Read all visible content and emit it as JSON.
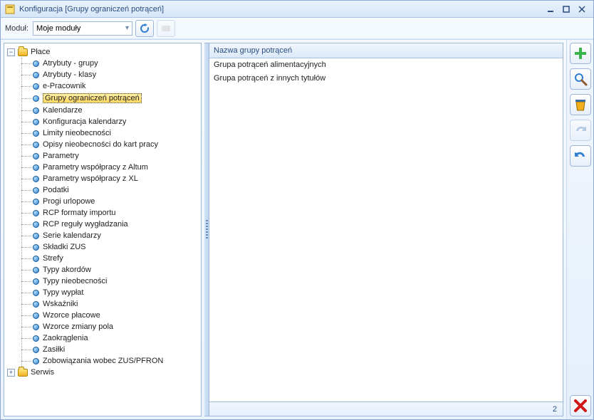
{
  "window": {
    "title": "Konfiguracja [Grupy ograniczeń potrąceń]"
  },
  "toolbar": {
    "module_label": "Moduł:",
    "module_value": "Moje moduły"
  },
  "tree": {
    "roots": [
      {
        "label": "Płace",
        "expanded": true,
        "children": [
          {
            "label": "Atrybuty - grupy"
          },
          {
            "label": "Atrybuty - klasy"
          },
          {
            "label": "e-Pracownik"
          },
          {
            "label": "Grupy ograniczeń potrąceń",
            "selected": true
          },
          {
            "label": "Kalendarze"
          },
          {
            "label": "Konfiguracja kalendarzy"
          },
          {
            "label": "Limity nieobecności"
          },
          {
            "label": "Opisy nieobecności do kart pracy"
          },
          {
            "label": "Parametry"
          },
          {
            "label": "Parametry współpracy z Altum"
          },
          {
            "label": "Parametry współpracy z XL"
          },
          {
            "label": "Podatki"
          },
          {
            "label": "Progi urlopowe"
          },
          {
            "label": "RCP formaty importu"
          },
          {
            "label": "RCP reguły wygładzania"
          },
          {
            "label": "Serie kalendarzy"
          },
          {
            "label": "Składki ZUS"
          },
          {
            "label": "Strefy"
          },
          {
            "label": "Typy akordów"
          },
          {
            "label": "Typy nieobecności"
          },
          {
            "label": "Typy wypłat"
          },
          {
            "label": "Wskaźniki"
          },
          {
            "label": "Wzorce płacowe"
          },
          {
            "label": "Wzorce zmiany pola"
          },
          {
            "label": "Zaokrąglenia"
          },
          {
            "label": "Zasiłki"
          },
          {
            "label": "Zobowiązania wobec ZUS/PFRON"
          }
        ]
      },
      {
        "label": "Serwis",
        "expanded": false
      }
    ]
  },
  "list": {
    "header": "Nazwa grupy potrąceń",
    "rows": [
      "Grupa potrąceń alimentacyjnych",
      "Grupa potrąceń z innych tytułów"
    ],
    "count": "2"
  }
}
